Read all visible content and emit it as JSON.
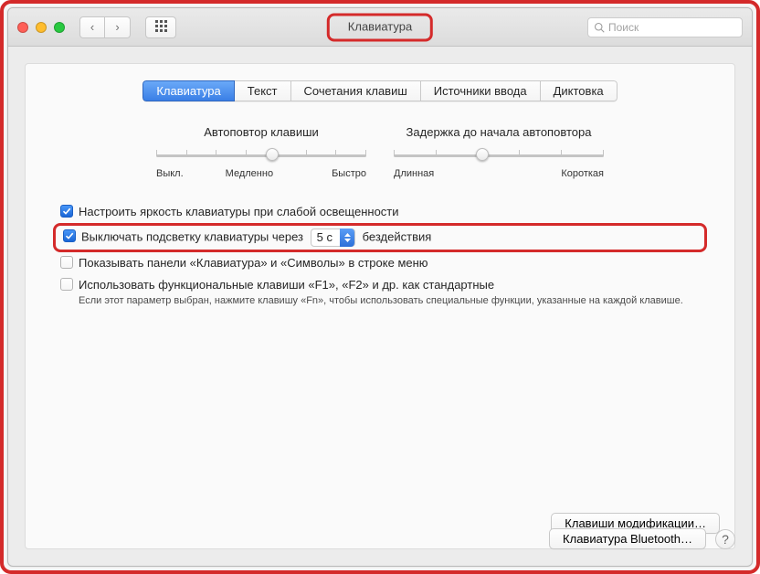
{
  "title": "Клавиатура",
  "search_placeholder": "Поиск",
  "tabs": [
    "Клавиатура",
    "Текст",
    "Сочетания клавиш",
    "Источники ввода",
    "Диктовка"
  ],
  "slider1": {
    "title": "Автоповтор клавиши",
    "labels": [
      "Выкл.",
      "Медленно",
      "Быстро"
    ]
  },
  "slider2": {
    "title": "Задержка до начала автоповтора",
    "labels": [
      "Длинная",
      "Короткая"
    ]
  },
  "checks": {
    "adjust_brightness": "Настроить яркость клавиатуры при слабой освещенности",
    "turn_off_prefix": "Выключать подсветку клавиатуры через",
    "turn_off_value": "5 с",
    "turn_off_suffix": "бездействия",
    "show_viewer": "Показывать панели «Клавиатура» и «Символы» в строке меню",
    "fn_keys": "Использовать функциональные клавиши «F1», «F2» и др. как стандартные",
    "fn_hint": "Если этот параметр выбран, нажмите клавишу «Fn», чтобы использовать специальные функции, указанные на каждой клавише."
  },
  "buttons": {
    "modifier": "Клавиши модификации…",
    "bluetooth": "Клавиатура Bluetooth…"
  }
}
